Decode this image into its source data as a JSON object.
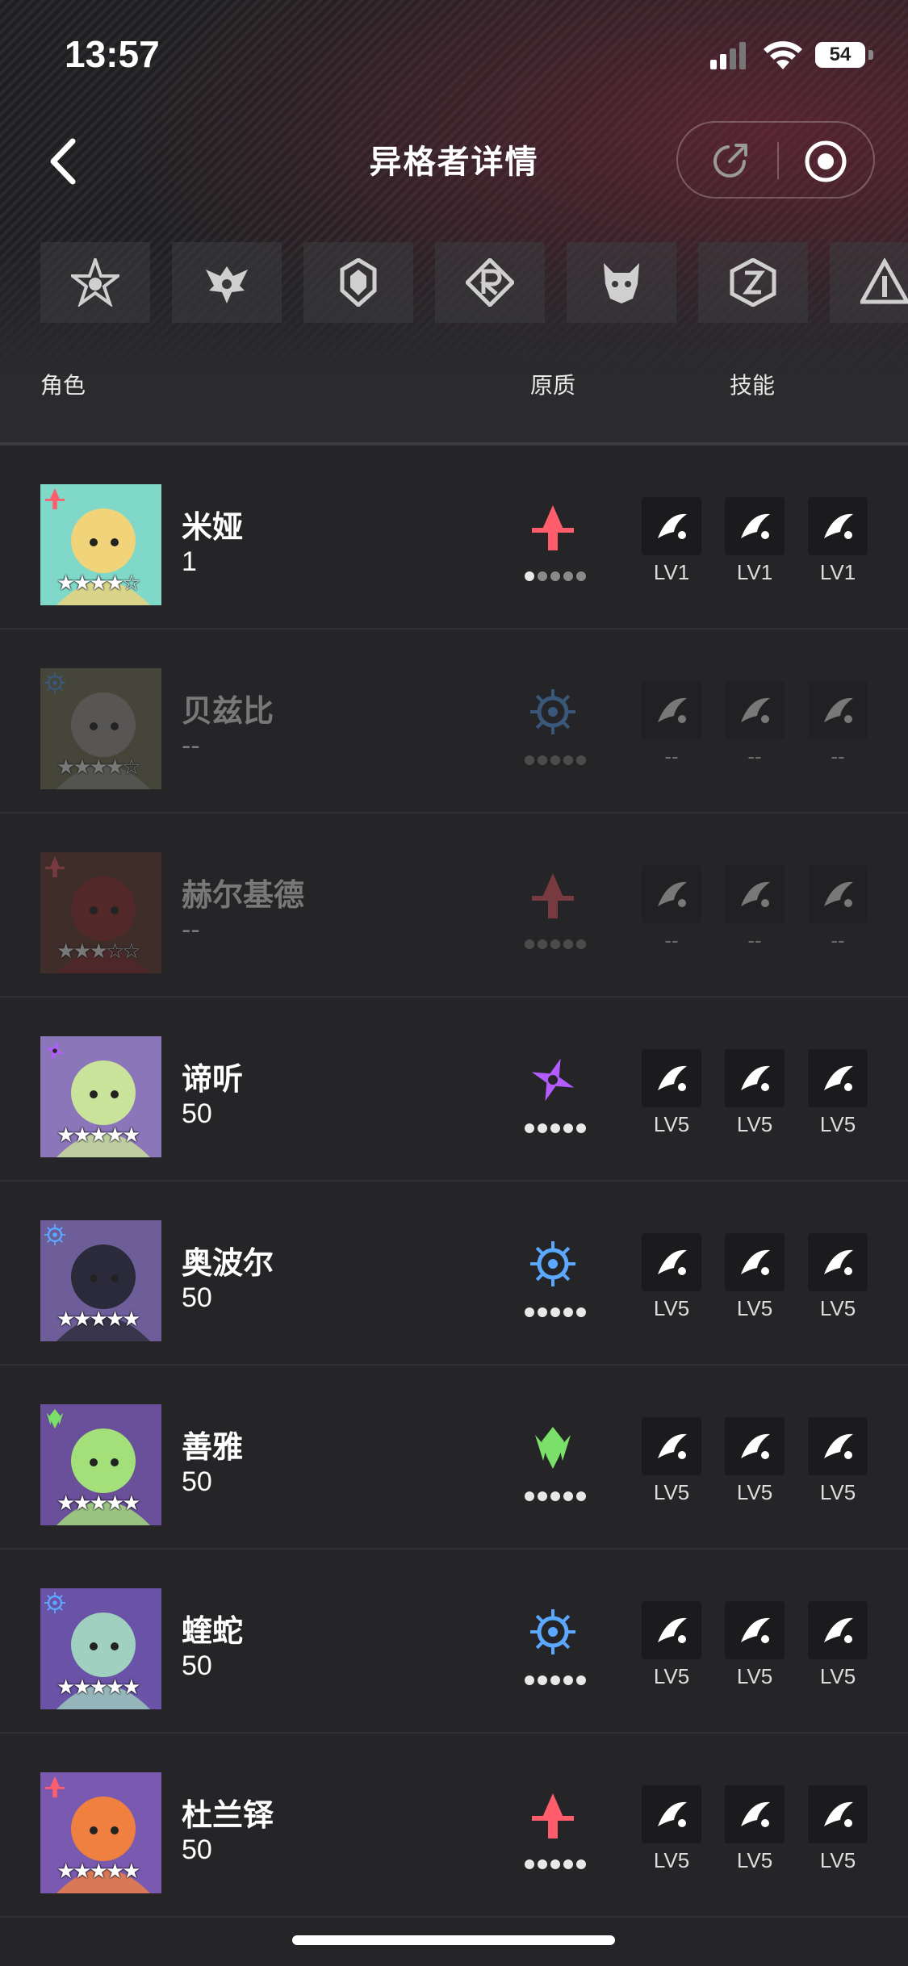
{
  "status_bar": {
    "time": "13:57",
    "battery": "54"
  },
  "header": {
    "title": "异格者详情"
  },
  "factions": [
    {
      "icon": "faction-star-emblem-icon"
    },
    {
      "icon": "faction-winged-crest-icon"
    },
    {
      "icon": "faction-shield-crest-icon"
    },
    {
      "icon": "faction-r-diamond-icon"
    },
    {
      "icon": "faction-beast-mask-icon"
    },
    {
      "icon": "faction-hex-rune-icon"
    },
    {
      "icon": "faction-triangle-icon"
    }
  ],
  "columns": {
    "role": "角色",
    "quality": "原质",
    "skills": "技能"
  },
  "colors": {
    "accent_red": "#ff5d6c",
    "accent_blue": "#5aa8ff",
    "accent_purple": "#b45cff",
    "accent_green": "#7be06a"
  },
  "characters": [
    {
      "name": "米娅",
      "level": "1",
      "stars": "★★★★☆",
      "element": "red-arrow-emblem",
      "owned": true,
      "skills": [
        {
          "icon": "fish-dash-icon",
          "lv": "LV1"
        },
        {
          "icon": "burst-spark-icon",
          "lv": "LV1"
        },
        {
          "icon": "bubble-orb-icon",
          "lv": "LV1"
        }
      ]
    },
    {
      "name": "贝兹比",
      "level": "--",
      "stars": "★★★★☆",
      "element": "blue-sun-eye-emblem",
      "owned": false,
      "skills": [
        {
          "icon": "wind-slash-icon",
          "lv": "--"
        },
        {
          "icon": "vortex-icon",
          "lv": "--"
        },
        {
          "icon": "blade-swoop-icon",
          "lv": "--"
        }
      ]
    },
    {
      "name": "赫尔基德",
      "level": "--",
      "stars": "★★★☆☆",
      "element": "red-arrow-emblem",
      "owned": false,
      "skills": [
        {
          "icon": "arrow-shot-icon",
          "lv": "--"
        },
        {
          "icon": "crossed-blades-icon",
          "lv": "--"
        },
        {
          "icon": "spike-crown-icon",
          "lv": "--"
        }
      ]
    },
    {
      "name": "谛听",
      "level": "50",
      "stars": "★★★★★",
      "element": "purple-shuriken-emblem",
      "owned": true,
      "skills": [
        {
          "icon": "dash-arrow-icon",
          "lv": "LV5"
        },
        {
          "icon": "net-grid-icon",
          "lv": "LV5"
        },
        {
          "icon": "pin-drop-icon",
          "lv": "LV5"
        }
      ]
    },
    {
      "name": "奥波尔",
      "level": "50",
      "stars": "★★★★★",
      "element": "blue-sun-eye-emblem",
      "owned": true,
      "skills": [
        {
          "icon": "claw-strike-icon",
          "lv": "LV5"
        },
        {
          "icon": "whirl-wave-icon",
          "lv": "LV5"
        },
        {
          "icon": "sphere-slash-icon",
          "lv": "LV5"
        }
      ]
    },
    {
      "name": "善雅",
      "level": "50",
      "stars": "★★★★★",
      "element": "green-leaf-emblem",
      "owned": true,
      "skills": [
        {
          "icon": "serpent-icon",
          "lv": "LV5"
        },
        {
          "icon": "butterfly-icon",
          "lv": "LV5"
        },
        {
          "icon": "plus-sparkle-icon",
          "lv": "LV5"
        }
      ]
    },
    {
      "name": "蝰蛇",
      "level": "50",
      "stars": "★★★★★",
      "element": "blue-sun-eye-emblem",
      "owned": true,
      "skills": [
        {
          "icon": "feather-strike-icon",
          "lv": "LV5"
        },
        {
          "icon": "lightning-burst-icon",
          "lv": "LV5"
        },
        {
          "icon": "spiral-shell-icon",
          "lv": "LV5"
        }
      ]
    },
    {
      "name": "杜兰铎",
      "level": "50",
      "stars": "★★★★★",
      "element": "red-arrow-emblem",
      "owned": true,
      "skills": [
        {
          "icon": "orbit-ring-icon",
          "lv": "LV5"
        },
        {
          "icon": "tornado-icon",
          "lv": "LV5"
        },
        {
          "icon": "swirl-fist-icon",
          "lv": "LV5"
        }
      ]
    }
  ]
}
